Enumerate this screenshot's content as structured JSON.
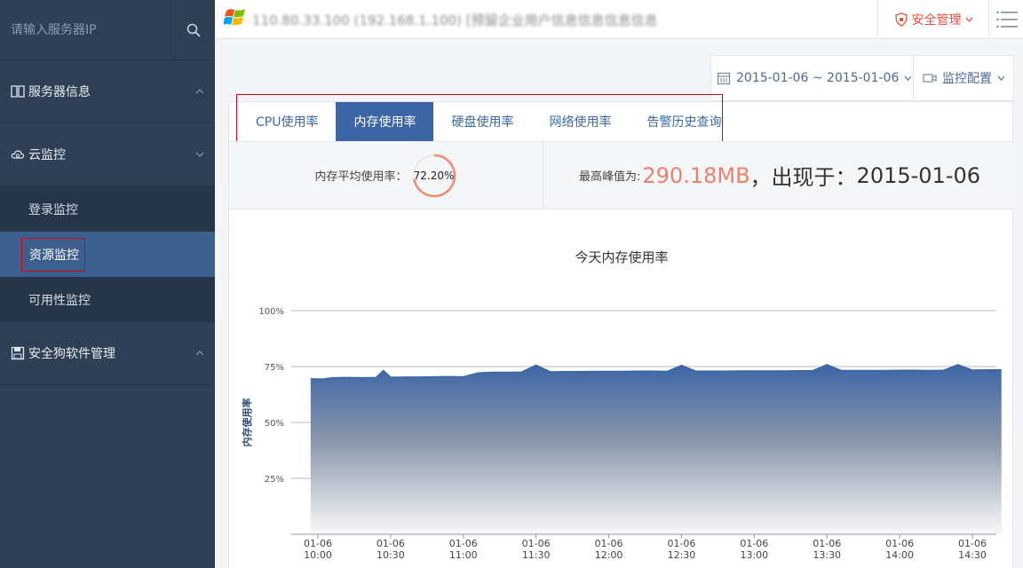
{
  "sidebar": {
    "search_placeholder": "请输入服务器IP",
    "groups": [
      {
        "label": "服务器信息"
      },
      {
        "label": "云监控",
        "children": [
          {
            "label": "登录监控"
          },
          {
            "label": "资源监控",
            "active": true
          },
          {
            "label": "可用性监控"
          }
        ]
      },
      {
        "label": "安全狗软件管理"
      }
    ]
  },
  "header": {
    "title_obscured": "110.80.33.100 (192.168.1.100) [预留企业用户信息信息信息信息]",
    "security_label": "安全管理"
  },
  "toolbar": {
    "date_range": "2015-01-06 ~ 2015-01-06",
    "config_label": "监控配置"
  },
  "tabs": [
    {
      "label": "CPU使用率"
    },
    {
      "label": "内存使用率",
      "active": true
    },
    {
      "label": "硬盘使用率"
    },
    {
      "label": "网络使用率"
    },
    {
      "label": "告警历史查询"
    }
  ],
  "stats": {
    "avg_label": "内存平均使用率：",
    "avg_value": "72.20%",
    "avg_fraction": 0.722,
    "peak_label": "最高峰值为:",
    "peak_value": "290.18MB",
    "peak_sep": "，出现于：",
    "peak_date": "2015-01-06"
  },
  "colors": {
    "accent": "#3d66a7",
    "sidebar_bg": "#2f4056",
    "alert": "#ef7f6a",
    "highlight": "#d0021b"
  },
  "chart_data": {
    "type": "area",
    "title": "今天内存使用率",
    "ylabel": "内存使用率",
    "ylim": [
      0,
      100
    ],
    "yticks": [
      "25%",
      "50%",
      "75%",
      "100%"
    ],
    "ytick_values": [
      25,
      50,
      75,
      100
    ],
    "xtick_labels": [
      [
        "01-06",
        "10:00"
      ],
      [
        "01-06",
        "10:30"
      ],
      [
        "01-06",
        "11:00"
      ],
      [
        "01-06",
        "11:30"
      ],
      [
        "01-06",
        "12:00"
      ],
      [
        "01-06",
        "12:30"
      ],
      [
        "01-06",
        "13:00"
      ],
      [
        "01-06",
        "13:30"
      ],
      [
        "01-06",
        "14:00"
      ],
      [
        "01-06",
        "14:30"
      ]
    ],
    "x_minutes_from_10_00": [
      -3,
      2,
      6,
      12,
      18,
      24,
      27,
      30,
      36,
      42,
      48,
      54,
      60,
      66,
      72,
      78,
      84,
      90,
      96,
      102,
      108,
      114,
      120,
      126,
      132,
      138,
      144,
      150,
      156,
      162,
      168,
      174,
      180,
      186,
      192,
      198,
      204,
      210,
      216,
      222,
      228,
      234,
      240,
      246,
      252,
      258,
      264,
      270,
      276,
      282
    ],
    "values": [
      69.5,
      69.4,
      70.0,
      70.1,
      70.0,
      70.1,
      73.2,
      70.2,
      70.3,
      70.3,
      70.4,
      70.5,
      70.4,
      72.1,
      72.4,
      72.4,
      72.5,
      75.6,
      72.6,
      72.7,
      72.7,
      72.8,
      72.8,
      72.8,
      72.9,
      72.9,
      72.8,
      75.5,
      72.9,
      72.9,
      72.9,
      73.0,
      73.0,
      73.0,
      73.0,
      73.1,
      73.1,
      75.8,
      73.2,
      73.2,
      73.2,
      73.2,
      73.3,
      73.3,
      73.2,
      73.3,
      75.8,
      73.4,
      73.5,
      73.5
    ]
  }
}
